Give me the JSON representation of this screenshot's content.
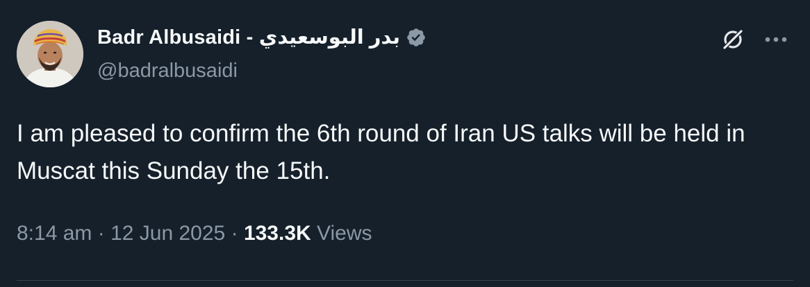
{
  "author": {
    "display_name": "Badr Albusaidi - بدر البوسعيدي",
    "handle": "@badralbusaidi",
    "verified": true,
    "verified_color": "#8b98a5"
  },
  "post": {
    "text": "I am pleased to confirm the 6th round of Iran US talks will be held in Muscat this Sunday the 15th."
  },
  "meta": {
    "time": "8:14 am",
    "separator": "·",
    "date": "12 Jun 2025",
    "views_count": "133.3K",
    "views_label": "Views"
  },
  "icons": {
    "grok": "grok-icon",
    "more": "more-icon",
    "verified": "verified-badge-icon"
  },
  "theme": {
    "background": "#15202b",
    "text_primary": "#f7f9f9",
    "text_secondary": "#8b98a5",
    "divider": "#38444d"
  }
}
